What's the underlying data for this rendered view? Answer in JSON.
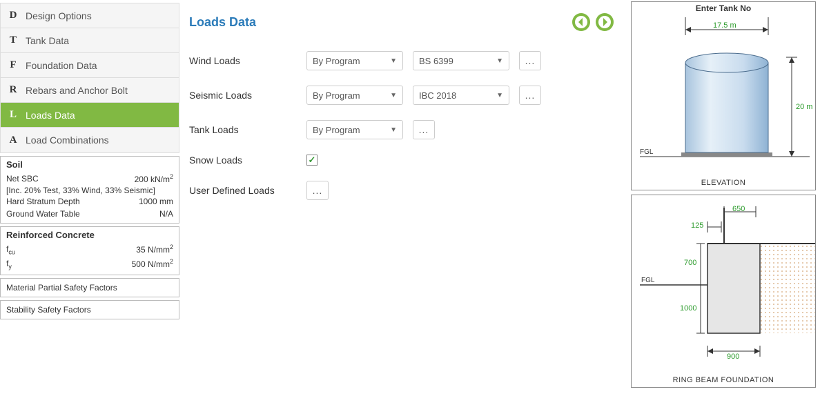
{
  "sidebar": {
    "items": [
      {
        "letter": "D",
        "label": "Design Options"
      },
      {
        "letter": "T",
        "label": "Tank Data"
      },
      {
        "letter": "F",
        "label": "Foundation Data"
      },
      {
        "letter": "R",
        "label": "Rebars and Anchor Bolt"
      },
      {
        "letter": "L",
        "label": "Loads Data",
        "active": true
      },
      {
        "letter": "A",
        "label": "Load Combinations"
      }
    ],
    "panels": {
      "soil": {
        "heading": "Soil",
        "net_sbc_label": "Net SBC",
        "net_sbc_value": "200 kN/m",
        "note": "[Inc. 20% Test, 33% Wind, 33% Seismic]",
        "hard_stratum_label": "Hard Stratum Depth",
        "hard_stratum_value": "1000 mm",
        "gwt_label": "Ground Water Table",
        "gwt_value": "N/A"
      },
      "concrete": {
        "heading": "Reinforced Concrete",
        "fcu_label": "f",
        "fcu_sub": "cu",
        "fcu_value": "35 N/mm",
        "fy_label": "f",
        "fy_sub": "y",
        "fy_value": "500 N/mm"
      },
      "mpsf_heading": "Material Partial Safety Factors",
      "ssf_heading": "Stability Safety Factors"
    }
  },
  "main": {
    "title": "Loads Data",
    "wind_label": "Wind Loads",
    "wind_sel1": "By Program",
    "wind_sel2": "BS 6399",
    "seismic_label": "Seismic Loads",
    "seismic_sel1": "By Program",
    "seismic_sel2": "IBC 2018",
    "tank_label": "Tank Loads",
    "tank_sel1": "By Program",
    "snow_label": "Snow Loads",
    "user_label": "User Defined Loads",
    "ellipsis": "..."
  },
  "diagrams": {
    "top": {
      "title": "Enter Tank No",
      "diameter": "17.5 m",
      "height": "20 m",
      "fgl": "FGL",
      "caption": "ELEVATION"
    },
    "bottom": {
      "d650": "650",
      "d125": "125",
      "d700": "700",
      "d1000": "1000",
      "d900": "900",
      "fgl": "FGL",
      "caption": "RING BEAM FOUNDATION"
    }
  }
}
